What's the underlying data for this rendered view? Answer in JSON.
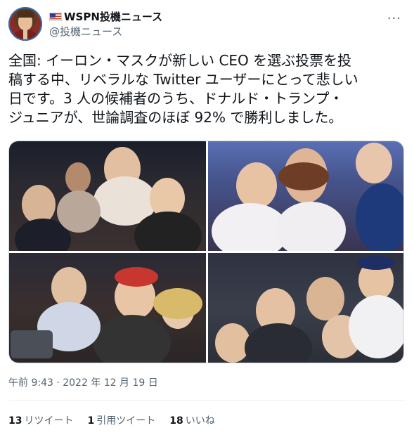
{
  "author": {
    "display_name": "WSPN投機ニュース",
    "handle": "@投機ニュース"
  },
  "tweet": {
    "text": "全国: イーロン・マスクが新しい CEO を選ぶ投票を投\n稿する中、リベラルな Twitter ユーザーにとって悲しい\n日です。3 人の候補者のうち、ドナルド・トランプ・\nジュニアが、世論調査のほぼ 92% で勝利しました。",
    "timestamp": "午前 9:43 · 2022 年 12 月 19 日"
  },
  "stats": {
    "retweets_count": "13",
    "retweets_label": "リツイート",
    "quotes_count": "1",
    "quotes_label": "引用ツイート",
    "likes_count": "18",
    "likes_label": "いいね"
  },
  "icons": {
    "more": "more-horizontal-icon",
    "flag": "us-flag-icon"
  }
}
